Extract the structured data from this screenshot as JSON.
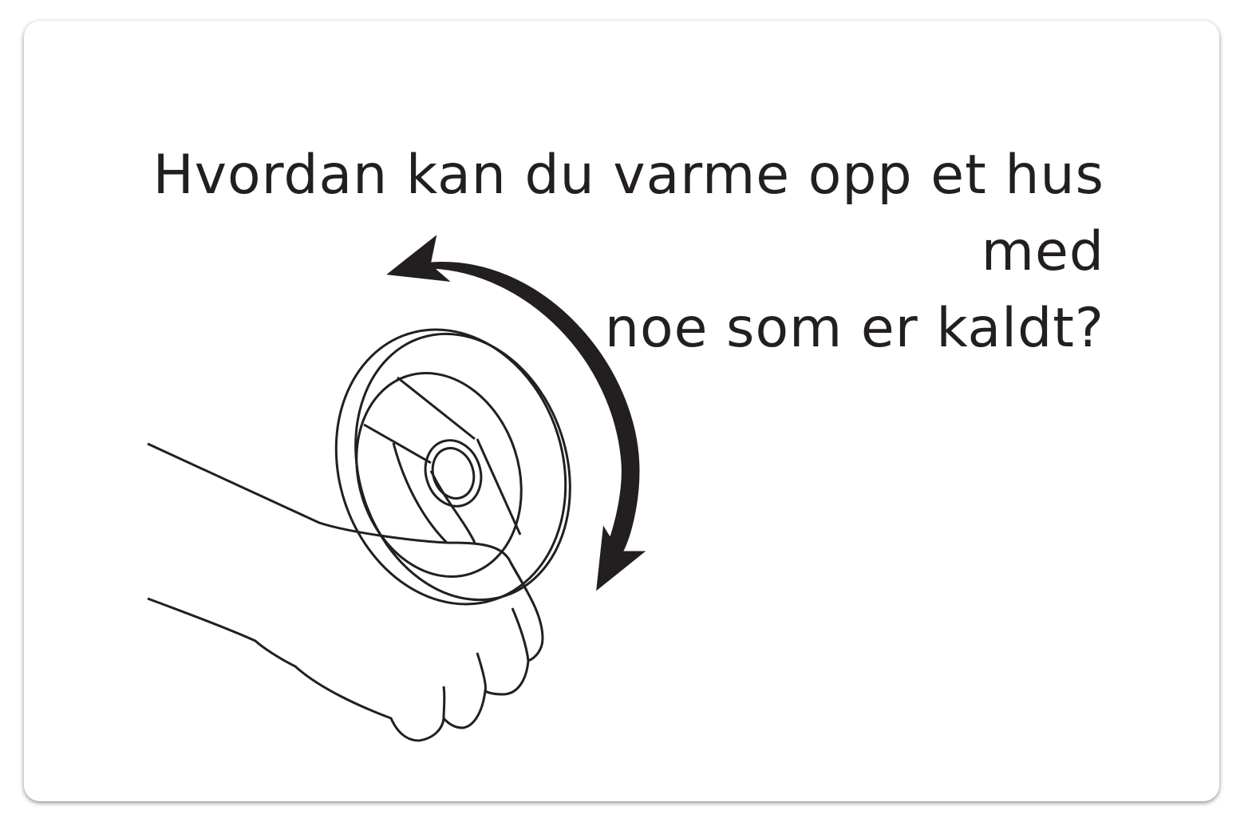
{
  "question": {
    "line1": "Hvordan kan du varme opp et hus med",
    "line2": "noe som er kaldt?"
  },
  "illustration": {
    "icon": "hand-turning-valve-icon",
    "rotation": "counter-clockwise"
  },
  "colors": {
    "ink": "#231f20",
    "background": "#ffffff"
  }
}
